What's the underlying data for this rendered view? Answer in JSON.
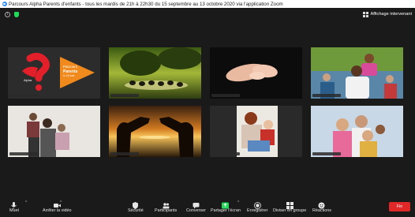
{
  "window": {
    "title": "Parcours Alpha Parents d'enfants - tous les mardis de 21h à 22h30 du 15 septembre au 13 octobre 2020 via l'application Zoom"
  },
  "header": {
    "view_label": "Affichage intervenant",
    "icons": [
      "info-icon",
      "shield-icon",
      "grid-view-icon"
    ]
  },
  "tiles": {
    "t1": {
      "logo_text": "Parcours",
      "logo_title": "Parents",
      "logo_sub": "0–10 ans",
      "brand": "Alpha"
    },
    "t2": {
      "scene": "geese-by-water"
    },
    "t3": {
      "scene": "hands"
    },
    "t4": {
      "scene": "family-outdoors"
    },
    "t5": {
      "scene": "family-portrait"
    },
    "t6": {
      "scene": "heart-hands-sunset"
    },
    "t7": {
      "scene": "mother-child-reading"
    },
    "t8": {
      "scene": "kids-smiling"
    }
  },
  "toolbar": {
    "mute_label": "Muet",
    "video_label": "Arrêter la vidéo",
    "security_label": "Sécurité",
    "participants_label": "Participants",
    "participants_count": "11",
    "chat_label": "Converser",
    "share_label": "Partager l'écran",
    "record_label": "Enregistrer",
    "rooms_label": "Diviser en groupe",
    "reactions_label": "Réactions",
    "end_label": "Fin"
  },
  "colors": {
    "end": "#e02828",
    "share": "#23d959",
    "alpha_red": "#e3202a",
    "alpha_orange": "#f08a1c"
  }
}
